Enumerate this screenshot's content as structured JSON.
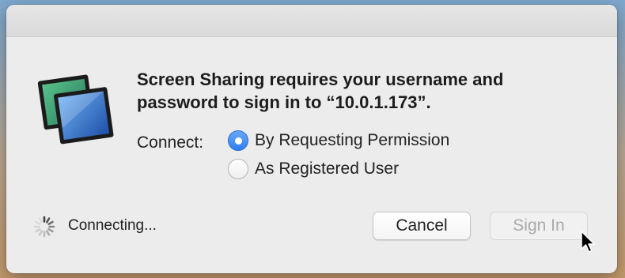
{
  "dialog": {
    "message": "Screen Sharing requires your username and password to sign in to “10.0.1.173”.",
    "app_icon": "screen-sharing-app-icon"
  },
  "connect": {
    "label": "Connect:",
    "options": [
      {
        "label": "By Requesting Permission",
        "selected": true
      },
      {
        "label": "As Registered User",
        "selected": false
      }
    ]
  },
  "status": {
    "text": "Connecting...",
    "icon": "spinner-icon"
  },
  "buttons": {
    "cancel_label": "Cancel",
    "signin_label": "Sign In",
    "signin_enabled": false
  },
  "colors": {
    "accent": "#3a84f2",
    "dialog_bg": "#ececec",
    "disabled_text": "#a9a9a9"
  }
}
